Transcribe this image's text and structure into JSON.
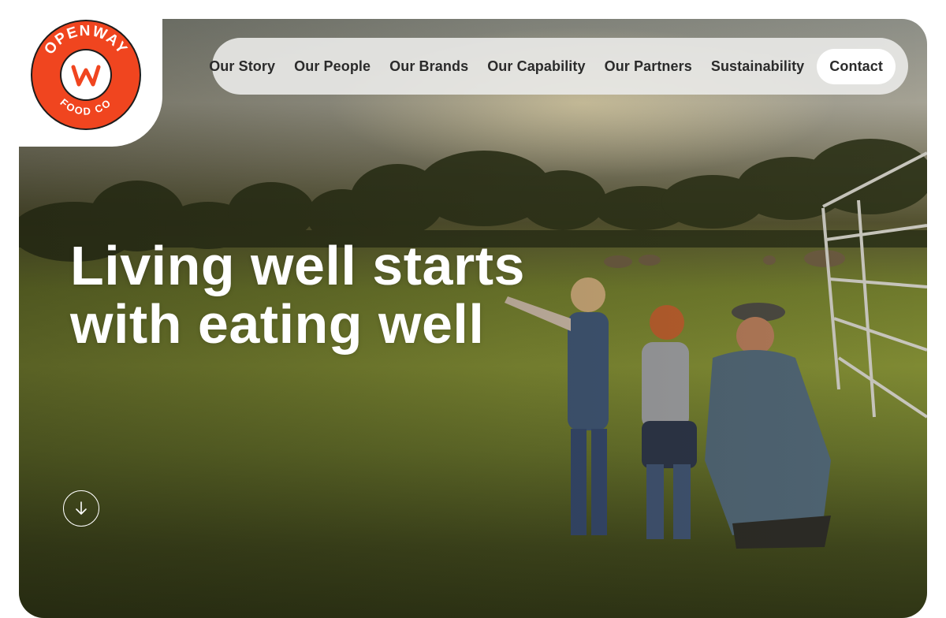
{
  "brand": {
    "logo_text_top": "OPENWAY",
    "logo_text_bottom": "FOOD CO",
    "logo_mark": "W",
    "color": "#f0451f"
  },
  "nav": {
    "items": [
      {
        "label": "Our Story"
      },
      {
        "label": "Our People"
      },
      {
        "label": "Our Brands"
      },
      {
        "label": "Our Capability"
      },
      {
        "label": "Our Partners"
      },
      {
        "label": "Sustainability"
      }
    ],
    "contact_label": "Contact"
  },
  "hero": {
    "headline_line1": "Living well starts",
    "headline_line2": "with eating well",
    "image_subject": "farm-field-family-photo",
    "scroll_icon": "arrow-down-icon"
  }
}
